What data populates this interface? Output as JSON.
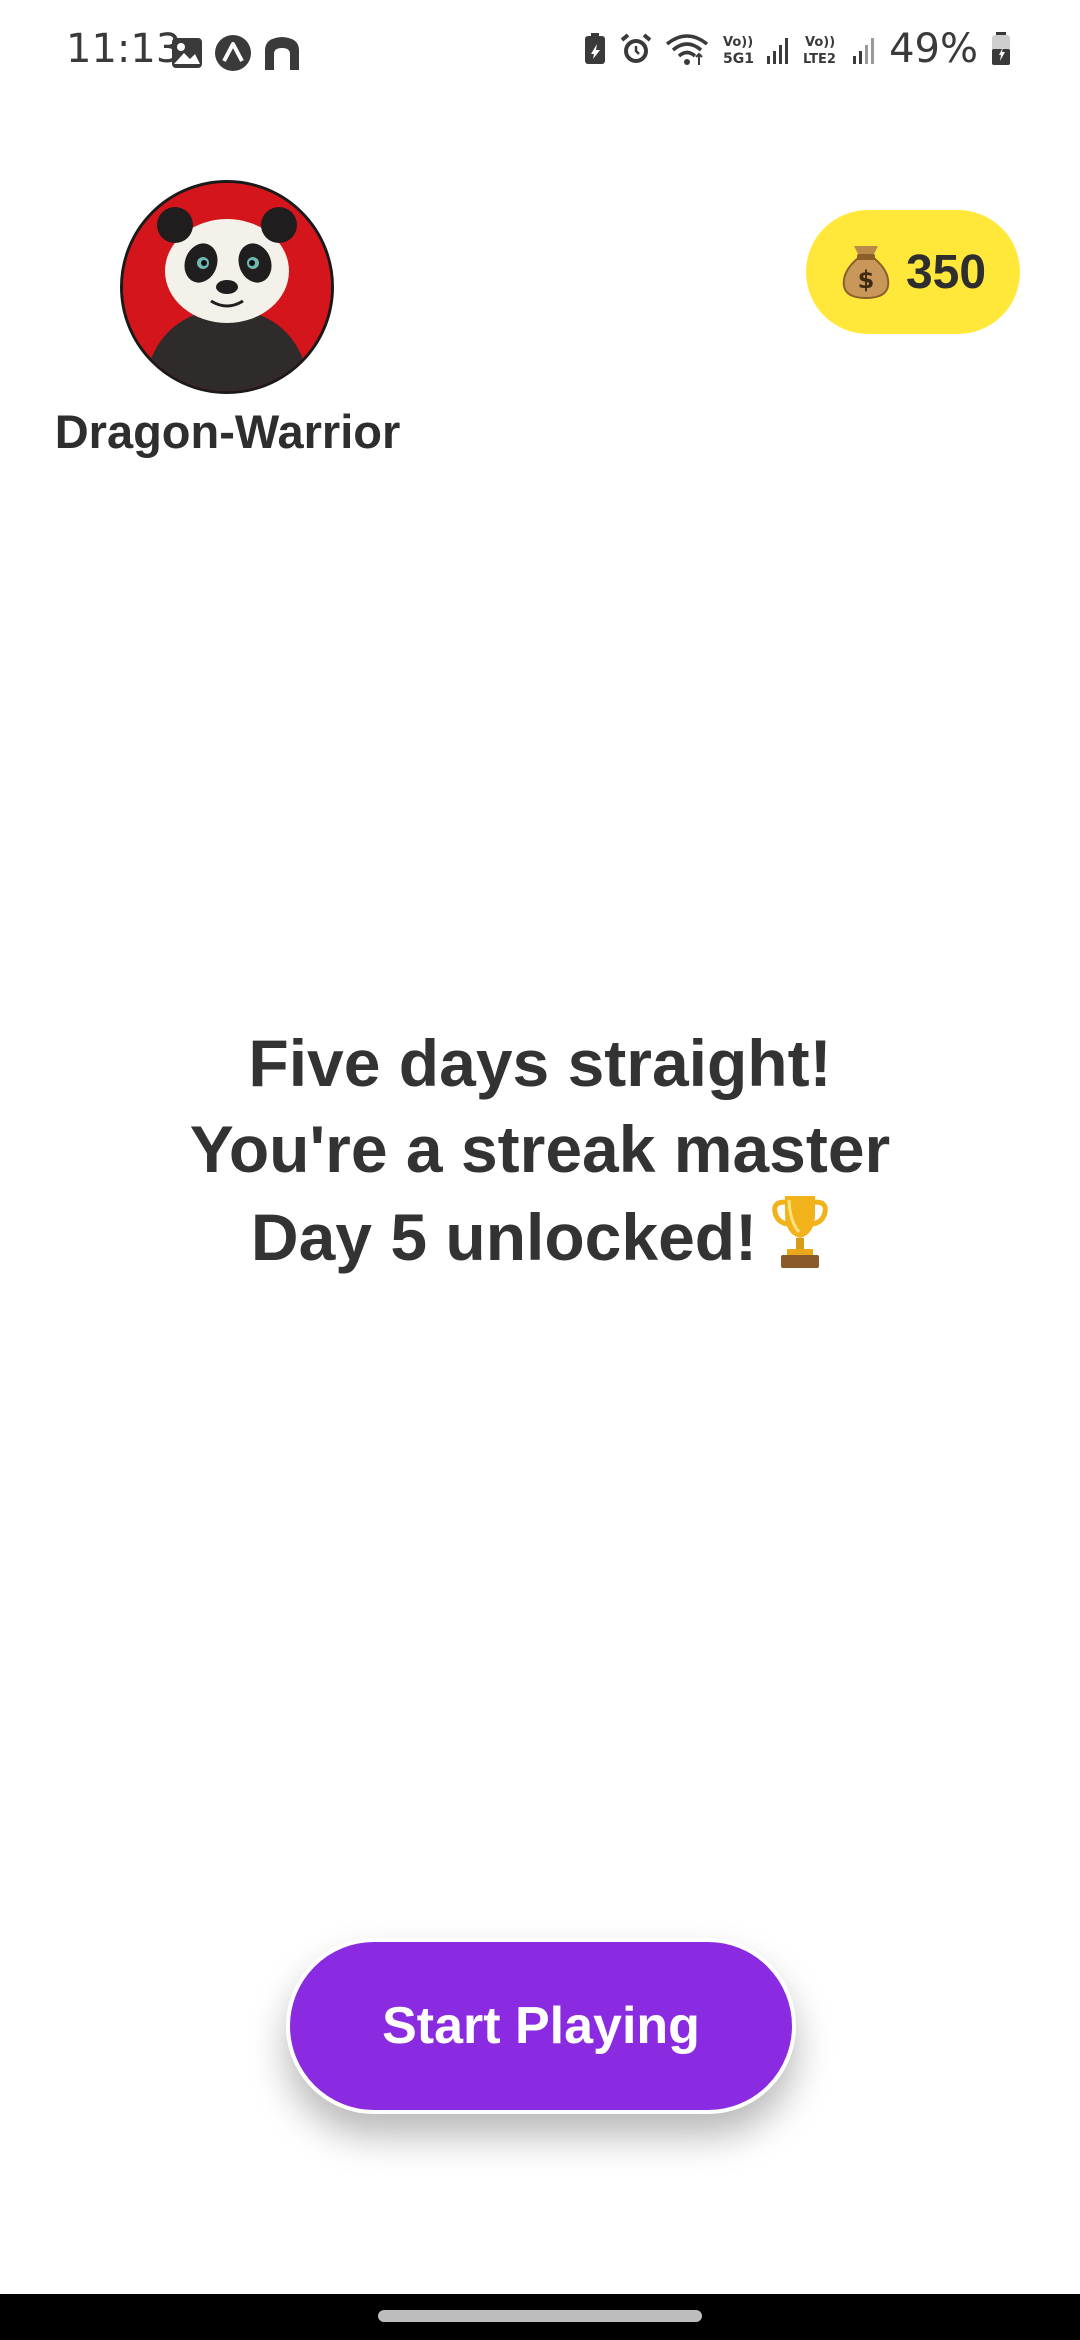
{
  "status_bar": {
    "time": "11:13",
    "battery_percent": "49%",
    "icons_left": [
      "gallery-icon",
      "app-icon",
      "home-app-icon"
    ],
    "icons_right": [
      "battery-saver-icon",
      "alarm-icon",
      "wifi-icon",
      "volte-5g-signal-icon",
      "volte-lte2-signal-icon",
      "battery-icon"
    ]
  },
  "profile": {
    "username": "Dragon-Warrior",
    "avatar_icon": "panda-avatar"
  },
  "coins": {
    "icon": "money-bag-icon",
    "value": "350",
    "pill_color": "#ffe83a"
  },
  "message": {
    "line1": "Five days straight!",
    "line2": "You're a streak master",
    "line3": "Day 5 unlocked!",
    "line3_icon": "trophy-icon"
  },
  "actions": {
    "start_label": "Start Playing",
    "button_color": "#8a2be2"
  }
}
